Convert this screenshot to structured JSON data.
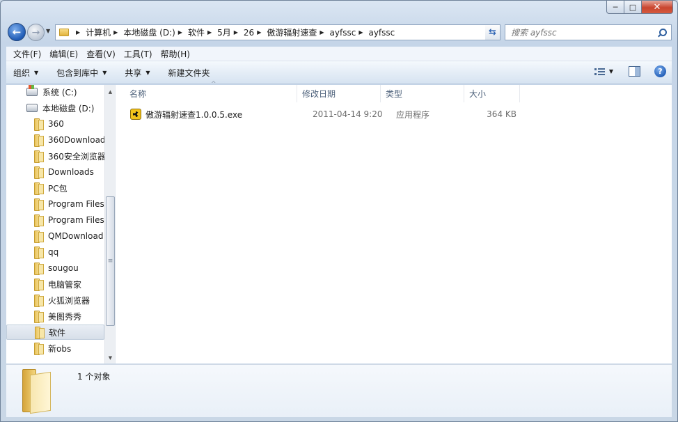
{
  "window": {
    "caption": {
      "minimize": "─",
      "maximize": "□",
      "close": "✕"
    }
  },
  "address": {
    "back_icon": "back-arrow-icon",
    "forward_icon": "forward-arrow-icon",
    "crumbs": [
      "计算机",
      "本地磁盘 (D:)",
      "软件",
      "5月",
      "26",
      "傲游辐射速查",
      "ayfssc",
      "ayfssc"
    ],
    "search_placeholder": "搜索 ayfssc"
  },
  "menu": [
    "文件(F)",
    "编辑(E)",
    "查看(V)",
    "工具(T)",
    "帮助(H)"
  ],
  "toolbar": {
    "organize": "组织",
    "include_in_library": "包含到库中",
    "share": "共享",
    "new_folder": "新建文件夹"
  },
  "nav_tree": [
    {
      "label": "系统 (C:)",
      "icon": "drive-icon",
      "indent": 1
    },
    {
      "label": "本地磁盘 (D:)",
      "icon": "drive-icon",
      "indent": 1
    },
    {
      "label": "360",
      "icon": "folder-icon",
      "indent": 2
    },
    {
      "label": "360Downloads",
      "icon": "folder-icon",
      "indent": 2
    },
    {
      "label": "360安全浏览器",
      "icon": "folder-icon",
      "indent": 2
    },
    {
      "label": "Downloads",
      "icon": "folder-icon",
      "indent": 2
    },
    {
      "label": "PC包",
      "icon": "folder-icon",
      "indent": 2
    },
    {
      "label": "Program Files",
      "icon": "folder-icon",
      "indent": 2
    },
    {
      "label": "Program Files",
      "icon": "folder-icon",
      "indent": 2
    },
    {
      "label": "QMDownload",
      "icon": "folder-icon",
      "indent": 2
    },
    {
      "label": "qq",
      "icon": "folder-icon",
      "indent": 2
    },
    {
      "label": "sougou",
      "icon": "folder-icon",
      "indent": 2
    },
    {
      "label": "电脑管家",
      "icon": "folder-icon",
      "indent": 2
    },
    {
      "label": "火狐浏览器",
      "icon": "folder-icon",
      "indent": 2
    },
    {
      "label": "美图秀秀",
      "icon": "folder-icon",
      "indent": 2
    },
    {
      "label": "软件",
      "icon": "folder-icon",
      "indent": 2,
      "selected": true
    },
    {
      "label": "新obs",
      "icon": "folder-icon",
      "indent": 2
    }
  ],
  "columns": [
    "名称",
    "修改日期",
    "类型",
    "大小"
  ],
  "files": [
    {
      "name": "傲游辐射速查1.0.0.5.exe",
      "modified": "2011-04-14 9:20",
      "type": "应用程序",
      "size": "364 KB",
      "icon": "radiation-app-icon"
    }
  ],
  "status": {
    "count": "1 个对象"
  }
}
